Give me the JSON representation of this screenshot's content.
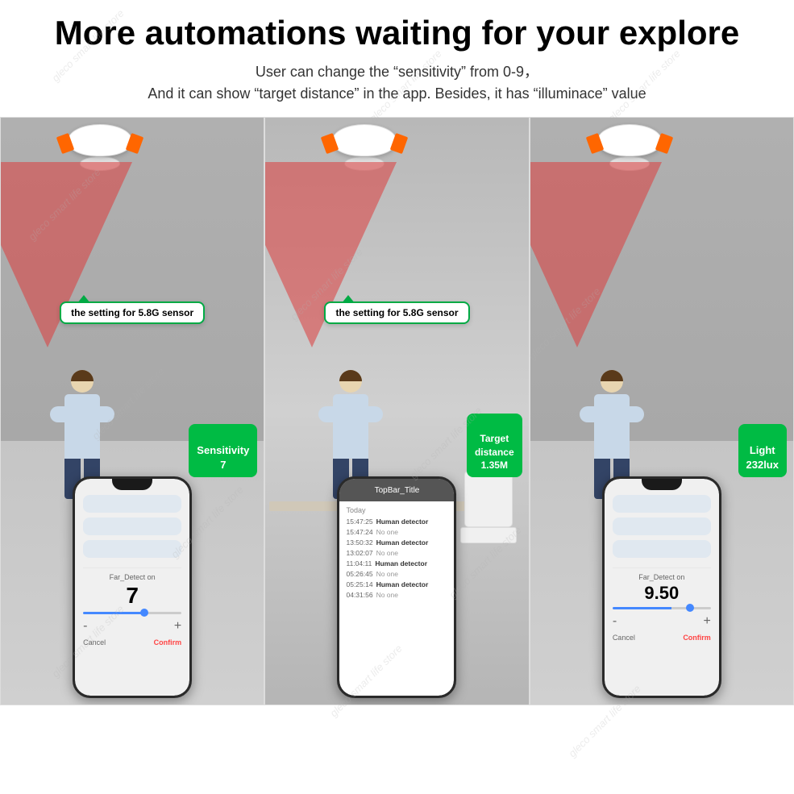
{
  "page": {
    "title": "More automations waiting for your explore",
    "subtitle_line1": "User can change the  “sensitivity”  from 0-9，",
    "subtitle_line2": "And it can show  “target distance”  in the app. Besides, it has  “illuminace”  value",
    "watermark_text": "gleco smart life store"
  },
  "panels": [
    {
      "id": "panel1",
      "tooltip": "the setting for 5.8G sensor",
      "badge_label": "Sensitivity\n7",
      "badge_color": "#00bb44",
      "phone": {
        "far_detect_label": "Far_Detect on",
        "far_detect_value": "7",
        "cancel_label": "Cancel",
        "confirm_label": "Confirm",
        "rows": 3
      }
    },
    {
      "id": "panel2",
      "tooltip": "the setting for 5.8G sensor",
      "badge_label": "Target\ndistance\n1.35M",
      "badge_color": "#00bb44",
      "phone": {
        "topbar_title": "TopBar_Title",
        "log_today": "Today",
        "log_entries": [
          {
            "time": "15:47:25",
            "event": "Human detector"
          },
          {
            "time": "15:47:24",
            "event": "No one"
          },
          {
            "time": "13:50:32",
            "event": "Human detector"
          },
          {
            "time": "13:02:07",
            "event": "No one"
          },
          {
            "time": "11:04:11",
            "event": "Human detector"
          },
          {
            "time": "05:26:45",
            "event": "No one"
          },
          {
            "time": "05:25:14",
            "event": "Human detector"
          },
          {
            "time": "04:31:56",
            "event": "No one"
          }
        ]
      }
    },
    {
      "id": "panel3",
      "badge_label": "Light\n232lux",
      "badge_color": "#00bb44",
      "phone": {
        "far_detect_label": "Far_Detect on",
        "far_detect_value": "9.50",
        "cancel_label": "Cancel",
        "confirm_label": "Confirm",
        "rows": 3
      }
    }
  ]
}
